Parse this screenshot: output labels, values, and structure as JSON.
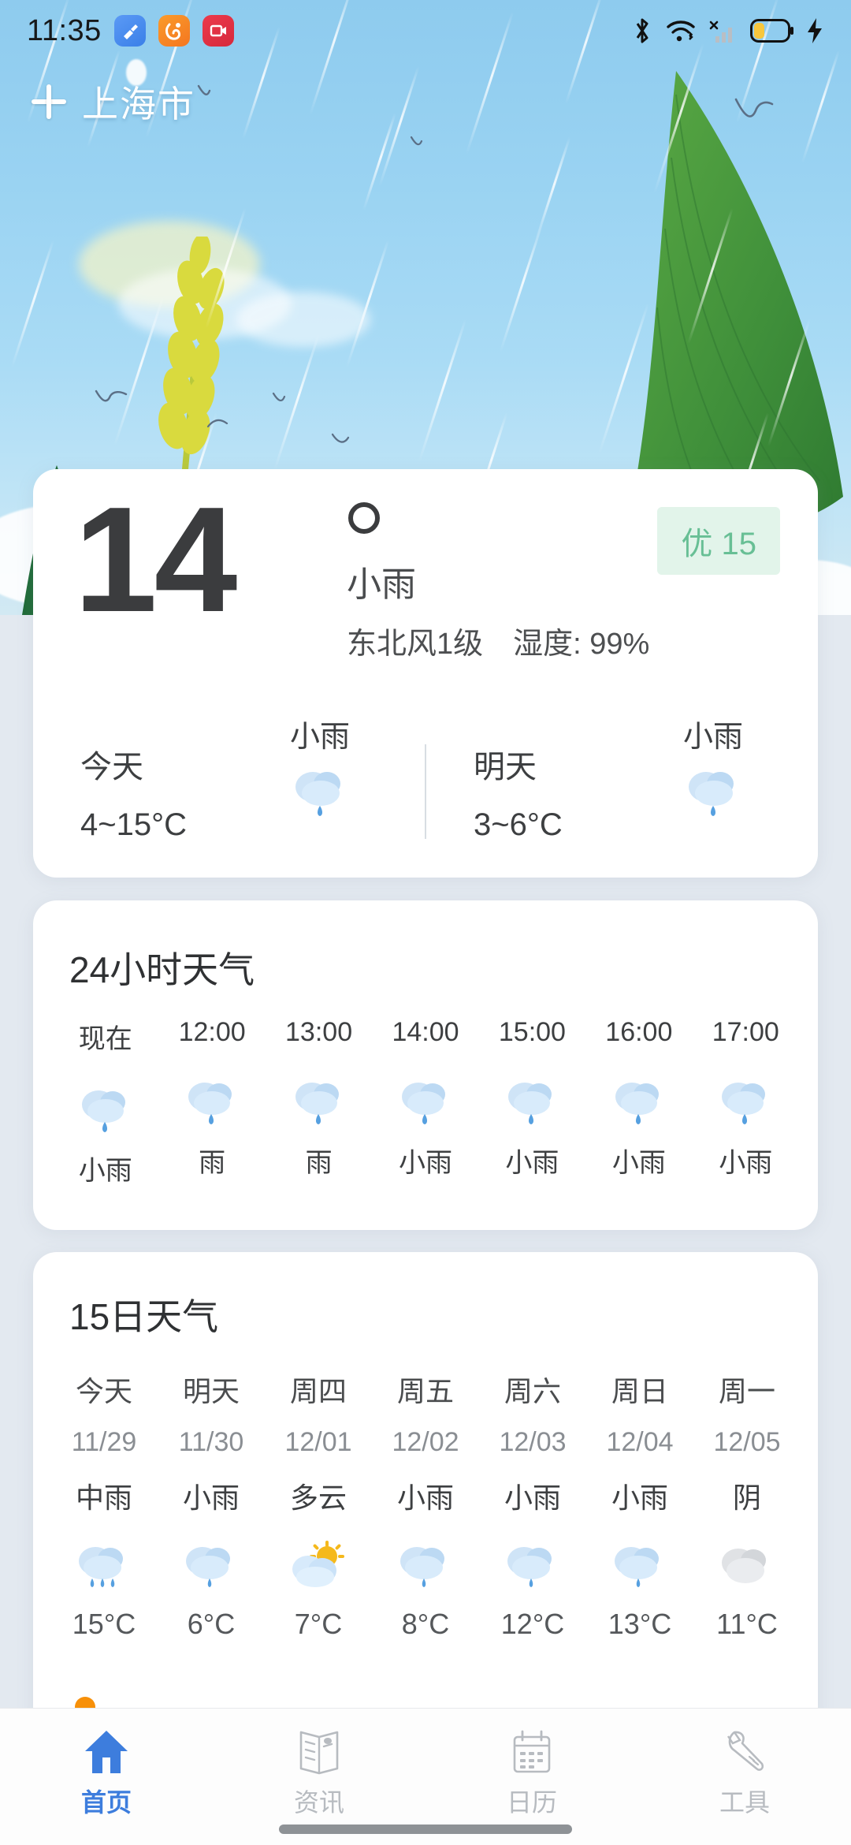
{
  "status_bar": {
    "time": "11:35",
    "app_icons": [
      "cleaner-app-icon",
      "uc-browser-app-icon",
      "screen-recorder-app-icon"
    ],
    "right_icons": [
      "bluetooth-icon",
      "wifi-icon",
      "cellular-signal-off-icon",
      "battery-icon",
      "charging-bolt-icon"
    ]
  },
  "header": {
    "add_icon": "plus-icon",
    "city": "上海市"
  },
  "current": {
    "temperature": "14",
    "degree_symbol": "°",
    "condition": "小雨",
    "wind": "东北风1级",
    "humidity": "湿度: 99%",
    "aqi_level": "优",
    "aqi_value": "15",
    "aqi_bg": "#e2f4ea",
    "aqi_color": "#68bf95",
    "today": {
      "label": "今天",
      "range": "4~15°C",
      "condition": "小雨",
      "icon": "light-rain-icon"
    },
    "tomorrow": {
      "label": "明天",
      "range": "3~6°C",
      "condition": "小雨",
      "icon": "light-rain-icon"
    }
  },
  "hourly": {
    "title": "24小时天气",
    "items": [
      {
        "time": "现在",
        "condition": "小雨",
        "icon": "light-rain-icon"
      },
      {
        "time": "12:00",
        "condition": "雨",
        "icon": "light-rain-icon"
      },
      {
        "time": "13:00",
        "condition": "雨",
        "icon": "light-rain-icon"
      },
      {
        "time": "14:00",
        "condition": "小雨",
        "icon": "light-rain-icon"
      },
      {
        "time": "15:00",
        "condition": "小雨",
        "icon": "light-rain-icon"
      },
      {
        "time": "16:00",
        "condition": "小雨",
        "icon": "light-rain-icon"
      },
      {
        "time": "17:00",
        "condition": "小雨",
        "icon": "light-rain-icon"
      }
    ]
  },
  "daily": {
    "title": "15日天气",
    "items": [
      {
        "day": "今天",
        "date": "11/29",
        "condition": "中雨",
        "icon": "moderate-rain-icon",
        "temp": "15°C"
      },
      {
        "day": "明天",
        "date": "11/30",
        "condition": "小雨",
        "icon": "light-rain-icon",
        "temp": "6°C"
      },
      {
        "day": "周四",
        "date": "12/01",
        "condition": "多云",
        "icon": "partly-cloudy-icon",
        "temp": "7°C"
      },
      {
        "day": "周五",
        "date": "12/02",
        "condition": "小雨",
        "icon": "light-rain-icon",
        "temp": "8°C"
      },
      {
        "day": "周六",
        "date": "12/03",
        "condition": "小雨",
        "icon": "light-rain-icon",
        "temp": "12°C"
      },
      {
        "day": "周日",
        "date": "12/04",
        "condition": "小雨",
        "icon": "light-rain-icon",
        "temp": "13°C"
      },
      {
        "day": "周一",
        "date": "12/05",
        "condition": "阴",
        "icon": "overcast-icon",
        "temp": "11°C"
      }
    ]
  },
  "nav": {
    "items": [
      {
        "label": "首页",
        "icon": "home-icon",
        "active": true
      },
      {
        "label": "资讯",
        "icon": "news-icon",
        "active": false
      },
      {
        "label": "日历",
        "icon": "calendar-icon",
        "active": false
      },
      {
        "label": "工具",
        "icon": "wrench-icon",
        "active": false
      }
    ],
    "active_color": "#3d7ddd",
    "inactive_color": "#b7bbc0"
  }
}
